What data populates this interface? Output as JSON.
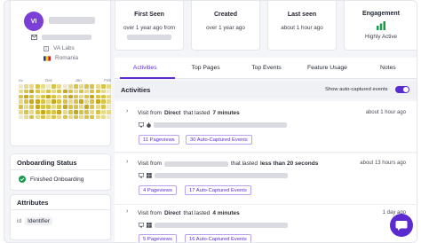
{
  "profile": {
    "initials": "VI",
    "org": "VA Labs",
    "country": "Romania",
    "heatmap_months": [
      "ov",
      "Dec",
      "Jan",
      "Feb"
    ],
    "heatmap_levels": [
      0,
      1,
      1,
      2,
      1,
      0,
      2,
      1,
      0,
      1,
      2,
      1,
      2,
      2,
      1,
      2,
      1,
      1,
      2,
      3,
      2,
      1,
      2,
      1,
      2,
      3,
      2,
      1,
      2,
      1,
      2,
      2,
      1,
      0,
      2,
      3,
      2,
      1,
      2,
      3,
      2,
      1,
      2,
      3,
      2,
      1,
      2,
      3,
      2,
      2,
      1,
      1,
      2,
      3,
      3,
      2,
      1,
      3,
      2,
      2,
      1,
      2,
      3,
      1,
      2,
      3,
      2,
      1,
      2,
      1,
      2,
      3,
      2,
      2,
      1,
      2,
      3,
      2,
      2,
      1,
      3,
      2,
      1,
      2,
      0,
      1,
      2,
      1,
      2,
      3,
      2,
      2,
      3,
      1,
      2,
      3,
      2,
      2,
      1,
      2,
      1,
      1,
      0,
      1,
      2,
      1,
      2,
      1,
      2,
      1,
      2,
      1,
      2,
      1,
      2,
      2,
      1,
      1,
      0
    ],
    "colors": {
      "accent": "#5b2bd1",
      "avatar": "#7b3fd6",
      "success": "#1a9a4c",
      "heat_levels": [
        "#ede8d2",
        "#e6d98c",
        "#d9c346",
        "#c9a81f"
      ]
    }
  },
  "onboarding": {
    "title": "Onboarding Status",
    "status": "Finished Onboarding"
  },
  "attributes": {
    "title": "Attributes",
    "key": "id",
    "value": "Identifier"
  },
  "stats": [
    {
      "title": "First Seen",
      "value": "over 1 year ago from"
    },
    {
      "title": "Created",
      "value": "over 1 year ago"
    },
    {
      "title": "Last seen",
      "value": "about 1 hour ago"
    },
    {
      "title": "Engagement",
      "value": "Highly Active"
    }
  ],
  "tabs": [
    "Activities",
    "Top Pages",
    "Top Events",
    "Feature Usage",
    "Notes"
  ],
  "activities": {
    "title": "Activities",
    "toggle_label": "Show auto-captured events",
    "toggle_on": true,
    "items": [
      {
        "prefix": "Visit from",
        "source": "Direct",
        "mid": "that lasted",
        "duration": "7 minutes",
        "ago": "about 1 hour ago",
        "pageviews": "11 Pageviews",
        "events": "30 Auto-Captured Events"
      },
      {
        "prefix": "Visit from",
        "source": "",
        "mid": "that lasted",
        "duration": "less than 20 seconds",
        "ago": "about 13 hours ago",
        "pageviews": "4 Pageviews",
        "events": "17 Auto-Captured Events"
      },
      {
        "prefix": "Visit from",
        "source": "Direct",
        "mid": "that lasted",
        "duration": "4 minutes",
        "ago": "1 day ago",
        "pageviews": "5 Pageviews",
        "events": "16 Auto-Captured Events"
      }
    ]
  }
}
